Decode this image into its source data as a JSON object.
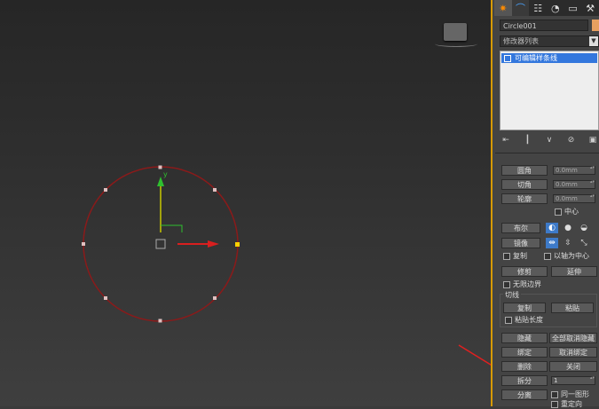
{
  "panel": {
    "tabs": [
      {
        "icon": "create-icon",
        "glyph": "✷"
      },
      {
        "icon": "modify-icon",
        "glyph": "⌒"
      },
      {
        "icon": "hierarchy-icon",
        "glyph": "☷"
      },
      {
        "icon": "motion-icon",
        "glyph": "◔"
      },
      {
        "icon": "display-icon",
        "glyph": "▭"
      },
      {
        "icon": "utilities-icon",
        "glyph": "⚒"
      }
    ],
    "object_name": "Circle001",
    "modifier_list": "修改器列表",
    "stack_item": "可编辑样条线",
    "stack_tools": [
      "⇤",
      "┃",
      "∨",
      "⊘",
      "▣"
    ],
    "rows": {
      "outline": "圆角",
      "outline_value": "0.0mm",
      "chamfer": "切角",
      "chamfer_value": "0.0mm",
      "contour": "轮廓",
      "contour_value": "0.0mm",
      "center": "中心",
      "boolean": "布尔",
      "mirror": "镜像",
      "copy": "复制",
      "about_pivot": "以轴为中心",
      "trim": "修剪",
      "extend": "延伸",
      "infinite": "无限边界",
      "tangent": "切线",
      "tan_copy": "复制",
      "tan_paste": "粘贴",
      "paste_length": "粘贴长度",
      "hide": "隐藏",
      "unhide_all": "全部取消隐藏",
      "bind": "绑定",
      "unbind": "取消绑定",
      "delete": "删除",
      "close": "关闭",
      "divide": "拆分",
      "divide_value": "1",
      "detach": "分离",
      "same_shape": "同一图形",
      "reorient": "重定向"
    }
  },
  "colors": {
    "accent": "#d79a00",
    "circle": "#8b1a1a",
    "gizmo_y": "#2fbf2f",
    "gizmo_x": "#d91f1f",
    "arrow": "#e02020"
  },
  "gizmo": {
    "y_label": "y"
  }
}
